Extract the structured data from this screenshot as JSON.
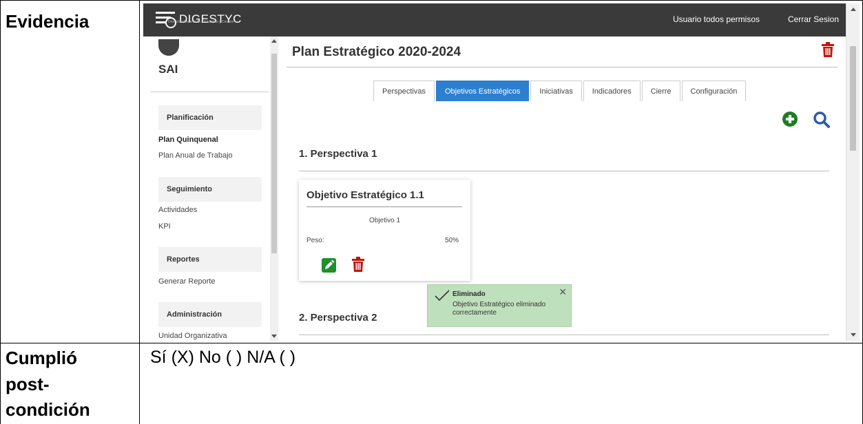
{
  "document": {
    "row1_label": "Evidencia",
    "row2_label_line1": "Cumplió",
    "row2_label_line2": "post-",
    "row2_label_line3": "condición",
    "row2_value": "Sí (X) No ( )  N/A ( )"
  },
  "app": {
    "logo_text": "DIGESTYC",
    "logo_subtitle": "Dirección General de Estadística y Censos",
    "user_label": "Usuario todos permisos",
    "logout_label": "Cerrar Sesion"
  },
  "sidebar": {
    "app_name": "SAI",
    "sections": [
      {
        "title": "Planificación",
        "items": [
          {
            "label": "Plan Quinquenal",
            "active": true
          },
          {
            "label": "Plan Anual de Trabajo",
            "active": false
          }
        ]
      },
      {
        "title": "Seguimiento",
        "items": [
          {
            "label": "Actividades"
          },
          {
            "label": "KPI"
          }
        ]
      },
      {
        "title": "Reportes",
        "items": [
          {
            "label": "Generar Reporte"
          }
        ]
      },
      {
        "title": "Administración",
        "items": [
          {
            "label": "Unidad Organizativa"
          }
        ]
      }
    ]
  },
  "main": {
    "title": "Plan Estratégico 2020-2024",
    "tabs": [
      {
        "label": "Perspectivas",
        "active": false
      },
      {
        "label": "Objetivos Estratégicos",
        "active": true
      },
      {
        "label": "Iniciativas",
        "active": false
      },
      {
        "label": "Indicadores",
        "active": false
      },
      {
        "label": "Cierre",
        "active": false
      },
      {
        "label": "Configuración",
        "active": false
      }
    ],
    "perspectives": [
      {
        "title": "1. Perspectiva 1"
      },
      {
        "title": "2. Perspectiva 2"
      }
    ],
    "card": {
      "title": "Objetivo Estratégico 1.1",
      "description": "Objetivo 1",
      "weight_label": "Peso:",
      "weight_value": "50%"
    },
    "toast": {
      "title": "Eliminado",
      "message": "Objetivo Estratégico eliminado correctamente"
    }
  },
  "colors": {
    "topbar": "#3a3a3a",
    "active_tab": "#2d7fd0",
    "add_icon": "#1e7d22",
    "search_icon": "#2f5aa8",
    "delete_icon": "#c0160f",
    "edit_button": "#1f8f2e",
    "toast_bg": "#bfe0bc"
  },
  "icons": [
    "logo-icon",
    "sai-icon",
    "trash-icon",
    "add-icon",
    "search-icon",
    "edit-icon",
    "check-icon",
    "close-icon"
  ]
}
